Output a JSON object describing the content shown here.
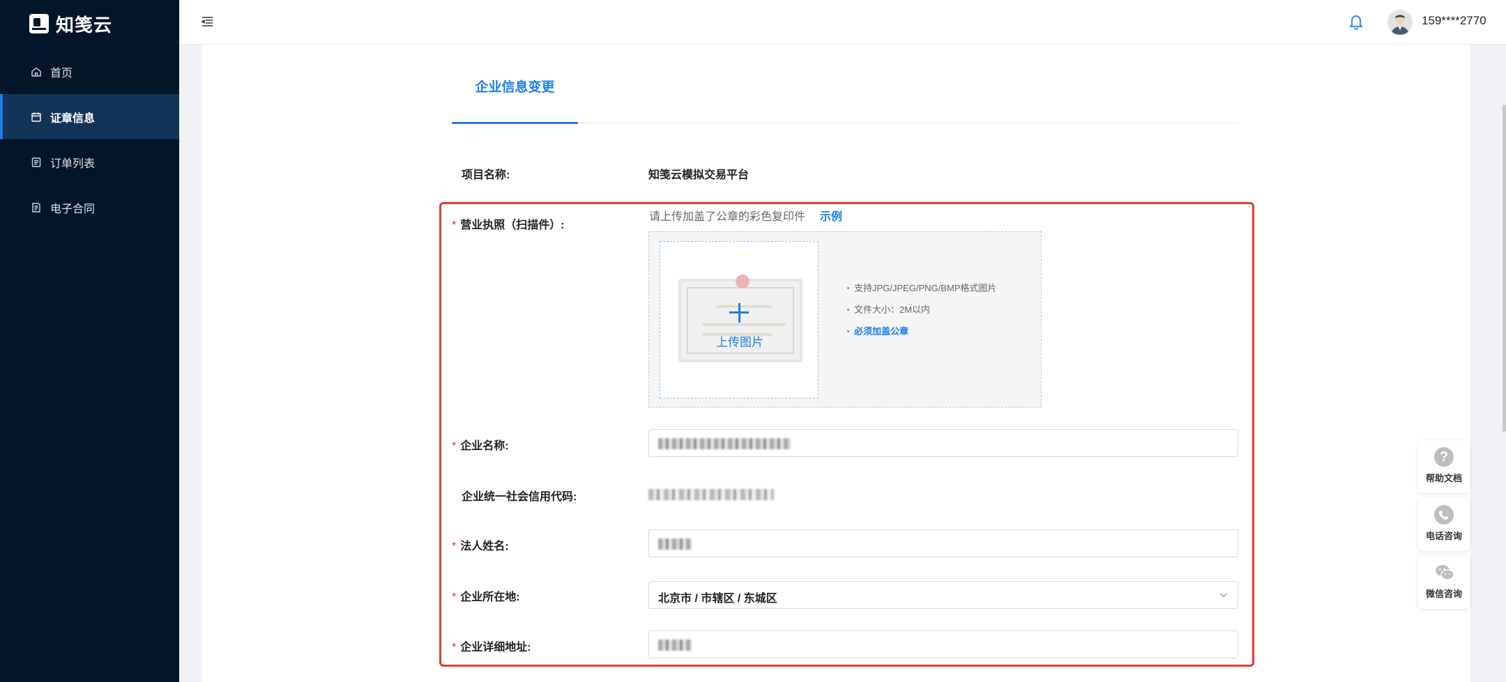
{
  "app": {
    "logo_text": "知笺云"
  },
  "sidebar": {
    "items": [
      {
        "label": "首页",
        "icon": "home-icon"
      },
      {
        "label": "证章信息",
        "icon": "seal-icon",
        "active": true
      },
      {
        "label": "订单列表",
        "icon": "list-icon"
      },
      {
        "label": "电子合同",
        "icon": "contract-icon"
      }
    ]
  },
  "header": {
    "username": "159****2770"
  },
  "tabs": [
    {
      "label": "企业信息变更",
      "active": true
    }
  ],
  "form": {
    "project_label": "项目名称:",
    "project_value": "知笺云模拟交易平台",
    "license_label": "营业执照（扫描件）:",
    "license_hint": "请上传加盖了公章的彩色复印件",
    "license_example": "示例",
    "upload_label": "上传图片",
    "tips": [
      "支持JPG/JPEG/PNG/BMP格式图片",
      "文件大小：2M以内",
      "必须加盖公章"
    ],
    "company_name_label": "企业名称:",
    "credit_code_label": "企业统一社会信用代码:",
    "legal_name_label": "法人姓名:",
    "location_label": "企业所在地:",
    "location_value": "北京市 / 市辖区 / 东城区",
    "address_label": "企业详细地址:",
    "required_mark": "*"
  },
  "float_tools": [
    {
      "label": "帮助文档",
      "icon": "help-icon"
    },
    {
      "label": "电话咨询",
      "icon": "phone-icon"
    },
    {
      "label": "微信咨询",
      "icon": "wechat-icon"
    }
  ],
  "colors": {
    "accent": "#1a7fe8",
    "sidebar_bg": "#021529",
    "sidebar_active": "#123457",
    "required": "#f5222d",
    "highlight_border": "#e53935"
  }
}
